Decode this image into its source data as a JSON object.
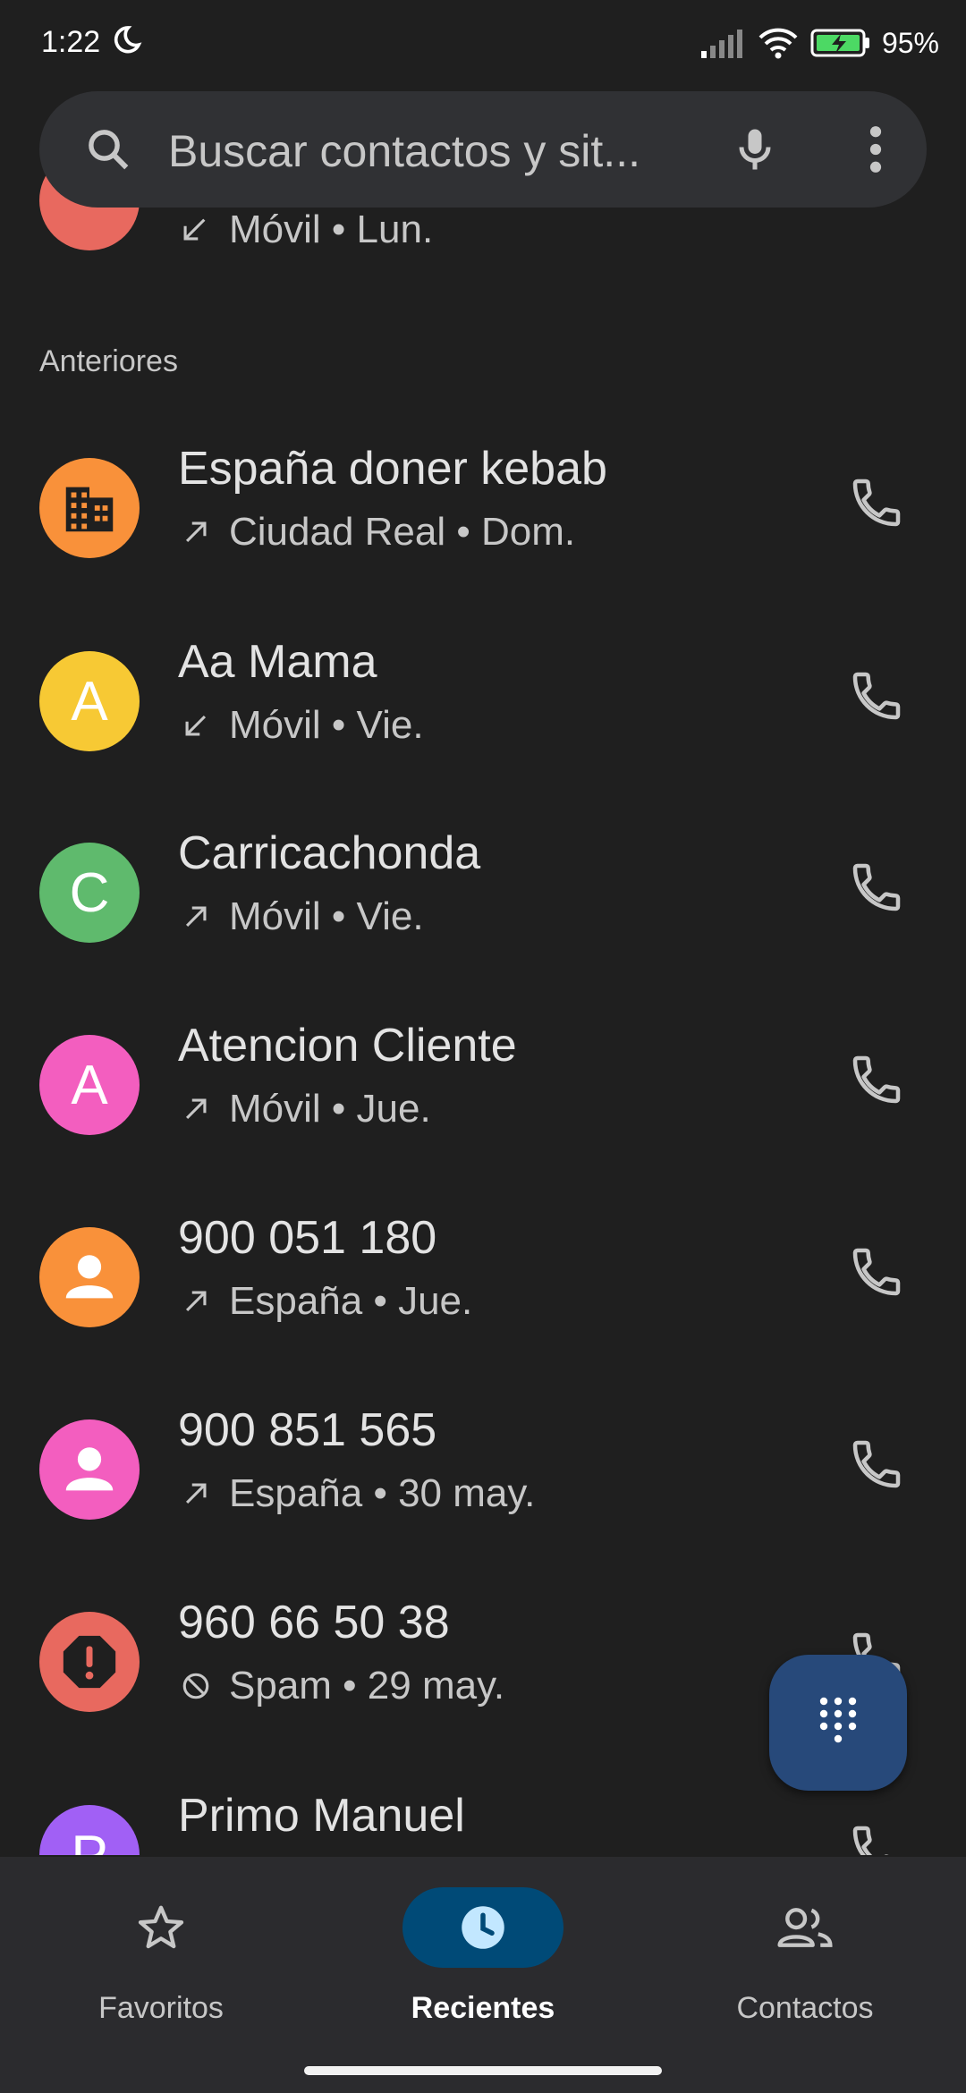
{
  "status_bar": {
    "time": "1:22",
    "battery": "95%"
  },
  "search": {
    "placeholder": "Buscar contactos y sit..."
  },
  "partial_row": {
    "sub": "Móvil • Lun."
  },
  "section": {
    "label": "Anteriores"
  },
  "calls": [
    {
      "name": "España doner kebab",
      "direction": "outgoing",
      "sub": "Ciudad Real • Dom.",
      "avatar": {
        "type": "business-icon",
        "color": "#f9913a"
      }
    },
    {
      "name": "Aa Mama",
      "direction": "incoming",
      "sub": "Móvil • Vie.",
      "avatar": {
        "type": "letter",
        "letter": "A",
        "color": "#f7c934"
      }
    },
    {
      "name": "Carricachonda",
      "direction": "outgoing",
      "sub": "Móvil • Vie.",
      "avatar": {
        "type": "letter",
        "letter": "C",
        "color": "#5fba6d"
      }
    },
    {
      "name": "Atencion Cliente",
      "direction": "outgoing",
      "sub": "Móvil • Jue.",
      "avatar": {
        "type": "letter",
        "letter": "A",
        "color": "#f35ebf"
      }
    },
    {
      "name": "900 051 180",
      "direction": "outgoing",
      "sub": "España • Jue.",
      "avatar": {
        "type": "person-icon",
        "color": "#f9913a"
      }
    },
    {
      "name": "900 851 565",
      "direction": "outgoing",
      "sub": "España • 30 may.",
      "avatar": {
        "type": "person-icon",
        "color": "#f35ebf"
      }
    },
    {
      "name": "960 66 50 38",
      "direction": "blocked",
      "sub": "Spam • 29 may.",
      "avatar": {
        "type": "spam-icon",
        "color": "#e8695f"
      }
    },
    {
      "name": "Primo Manuel",
      "direction": "",
      "sub": "",
      "avatar": {
        "type": "letter",
        "letter": "P",
        "color": "#a160f5"
      }
    }
  ],
  "nav": [
    {
      "label": "Favoritos",
      "icon": "star-icon",
      "active": false
    },
    {
      "label": "Recientes",
      "icon": "clock-icon",
      "active": true
    },
    {
      "label": "Contactos",
      "icon": "people-icon",
      "active": false
    }
  ],
  "colors": {
    "background": "#1f1f1f",
    "search_bg": "#303134",
    "fab": "#27497a",
    "nav_active": "#004a77"
  }
}
